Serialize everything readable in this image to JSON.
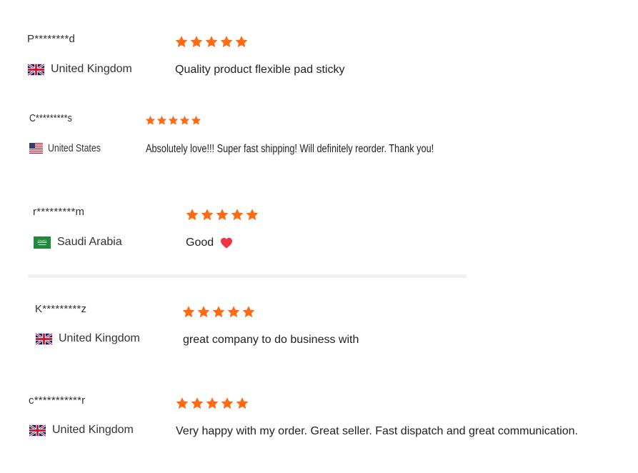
{
  "colors": {
    "star": "#ff6a13",
    "heart": "#ee3344",
    "divider": "#f1f1f1"
  },
  "reviews": [
    {
      "name": "P********d",
      "country": "United Kingdom",
      "flag": "uk-flag-icon",
      "rating": 5,
      "comment": "Quality product flexible pad sticky"
    },
    {
      "name": "C*********s",
      "country": "United States",
      "flag": "us-flag-icon",
      "rating": 5,
      "comment": "Absolutely love!!! Super fast shipping! Will definitely reorder. Thank you!"
    },
    {
      "name": "r*********m",
      "country": "Saudi Arabia",
      "flag": "saudi-flag-icon",
      "rating": 5,
      "comment": "Good",
      "emoji": "heart-icon"
    },
    {
      "name": "K*********z",
      "country": "United Kingdom",
      "flag": "uk-flag-icon",
      "rating": 5,
      "comment": "great company to do business with"
    },
    {
      "name": "c***********r",
      "country": "United Kingdom",
      "flag": "uk-flag-icon",
      "rating": 5,
      "comment": "Very happy with my order. Great seller. Fast dispatch and great communication."
    }
  ]
}
